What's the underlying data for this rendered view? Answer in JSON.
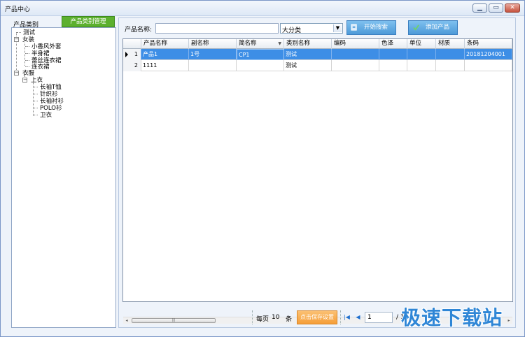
{
  "window": {
    "title": "产品中心"
  },
  "left": {
    "title": "产品类别",
    "manage_button": "产品类别管理",
    "tree": {
      "root_item": "测试",
      "groups": [
        {
          "label": "女装",
          "children": [
            "小香风外套",
            "半身裙",
            "蕾丝连衣裙",
            "连衣裙"
          ]
        },
        {
          "label": "衣服",
          "sub": {
            "label": "上衣",
            "children": [
              "长袖T恤",
              "针织衫",
              "长袖衬衫",
              "POLO衫",
              "卫衣"
            ]
          }
        }
      ]
    }
  },
  "toolbar": {
    "name_label": "产品名称:",
    "name_value": "",
    "category_select": "大分类",
    "search_button": "开始搜索",
    "add_button": "添加产品"
  },
  "grid": {
    "columns": [
      "产品名称",
      "副名称",
      "简名称",
      "类别名称",
      "编码",
      "色泽",
      "单位",
      "材质",
      "条码"
    ],
    "rows": [
      {
        "num": "1",
        "cells": [
          "产品1",
          "1号",
          "CP1",
          "测试",
          "",
          "",
          "",
          "",
          "20181204001"
        ],
        "selected": true
      },
      {
        "num": "2",
        "cells": [
          "1111",
          "",
          "",
          "测试",
          "",
          "",
          "",
          "",
          ""
        ],
        "selected": false
      }
    ]
  },
  "pager": {
    "per_page_label": "每页",
    "per_page_value": "10",
    "unit_label": "条",
    "save_button": "点击保存设置",
    "current_page": "1",
    "total_pages": "/ 1"
  },
  "watermark": "极速下载站",
  "colors": {
    "accent_blue": "#3d8ee6",
    "manage_green": "#5cb02e",
    "save_orange": "#f59e38"
  }
}
